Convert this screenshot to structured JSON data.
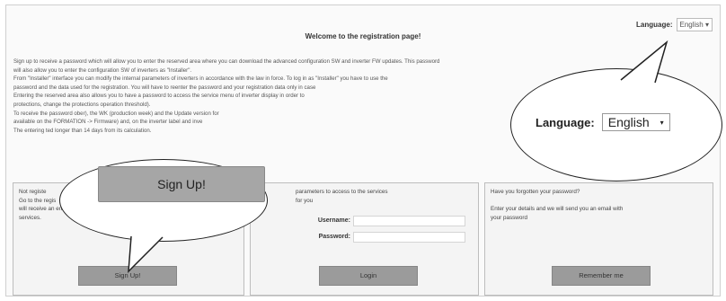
{
  "header": {
    "welcome": "Welcome to the registration page!",
    "language_label": "Language:",
    "language_value": "English"
  },
  "intro_lines": [
    "Sign up to receive a password which will allow you to enter the reserved area where you can download the advanced configuration SW and inverter FW updates. This password",
    "will also allow you to enter the configuration SW of inverters as \"Installer\".",
    "From \"Installer\" interface you can modify the internal parameters of inverters in accordance with the law in force. To log in as \"Installer\" you have to use the",
    "password and the data used for the registration. You will have to reenter the password and your registration data only in case",
    "Entering the reserved area also allows you to have a password to access the service menu of inverter display in order to",
    "protections, change the protections operation threshold).",
    "To receive the password                                                   ober), the WK (production week) and the Update version for",
    "available on the                                                                  FORMATION -> Firmware) and, on the inverter label and inve",
    "The entering                                                                       ted longer than 14 days from its calculation."
  ],
  "signup_box": {
    "lines": [
      "Not registe",
      "Go to the regis",
      "will receive an email",
      "services."
    ],
    "button": "Sign Up!"
  },
  "login_box": {
    "lines": [
      "parameters to access to the services",
      "for you"
    ],
    "username_label": "Username:",
    "password_label": "Password:",
    "button": "Login"
  },
  "forgot_box": {
    "lines": [
      "Have you forgotten your password?",
      "",
      "Enter your details and we will send you an email with",
      "your password"
    ],
    "button": "Remember me"
  },
  "callouts": {
    "language_label": "Language:",
    "language_value": "English",
    "signup_button": "Sign Up!"
  },
  "icons": {
    "dropdown_caret": "chevron-down-icon"
  }
}
